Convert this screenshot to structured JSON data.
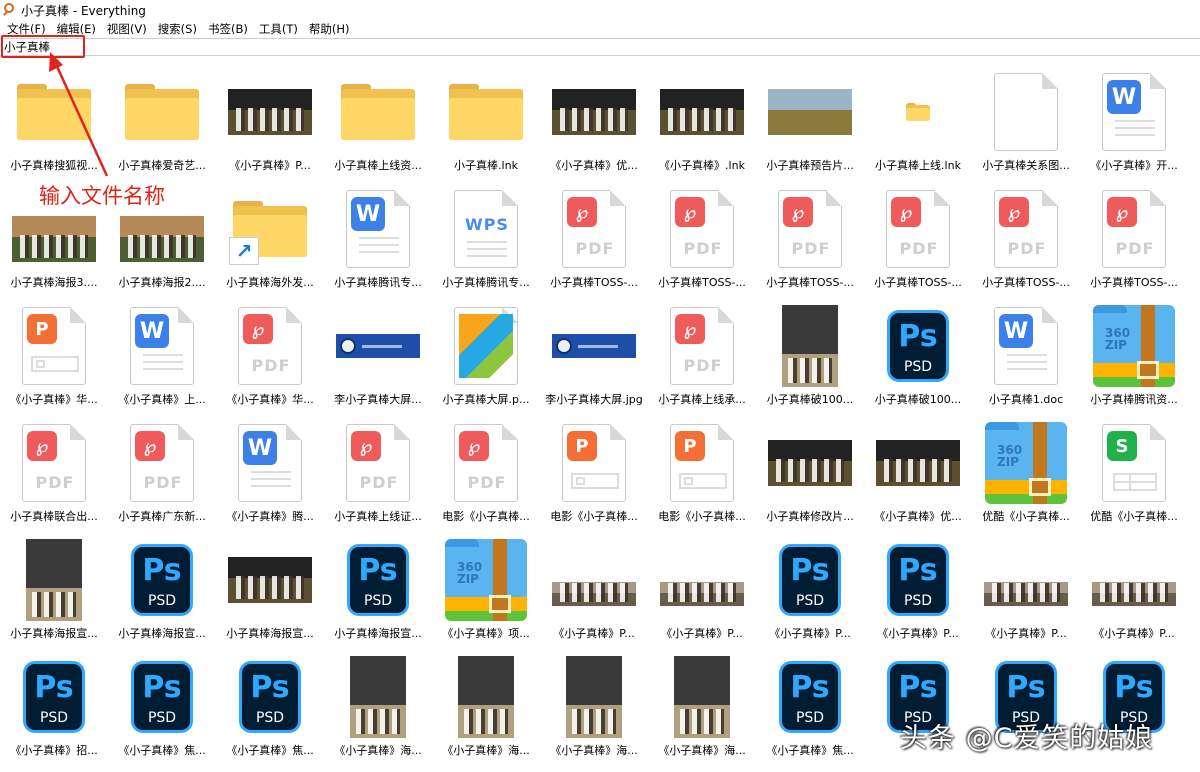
{
  "window": {
    "title": "小子真棒 - Everything"
  },
  "menu": [
    "文件(F)",
    "编辑(E)",
    "视图(V)",
    "搜索(S)",
    "书签(B)",
    "工具(T)",
    "帮助(H)"
  ],
  "search": {
    "value": "小子真棒"
  },
  "annotation": {
    "text": "输入文件名称",
    "color": "#e0231c"
  },
  "colors": {
    "ps_blue": "#31a8ff",
    "pdf_red": "#ef5a5a",
    "ppt_orange": "#f36f35",
    "word_blue": "#3d81e8",
    "xls_green": "#21b04a",
    "folder_yellow": "#ffd767"
  },
  "rows": [
    [
      {
        "icon": "folder",
        "name": "小子真棒搜狐视..."
      },
      {
        "icon": "folder",
        "name": "小子真棒爱奇艺..."
      },
      {
        "icon": "photo-dark",
        "name": "《小子真棒》P..."
      },
      {
        "icon": "folder",
        "name": "小子真棒上线资..."
      },
      {
        "icon": "folder",
        "name": "小子真棒.lnk"
      },
      {
        "icon": "photo-dark",
        "name": "《小子真棒》优..."
      },
      {
        "icon": "photo-dark",
        "name": "《小子真棒》.lnk"
      },
      {
        "icon": "photo-field",
        "name": "小子真棒预告片..."
      },
      {
        "icon": "folder-small",
        "name": "小子真棒上线.lnk"
      },
      {
        "icon": "doc-blank",
        "name": "小子真棒关系图..."
      },
      {
        "icon": "doc-word",
        "name": "《小子真棒》开..."
      }
    ],
    [
      {
        "icon": "photo-group",
        "name": "小子真棒海报3...."
      },
      {
        "icon": "photo-group",
        "name": "小子真棒海报2...."
      },
      {
        "icon": "folder-shortcut",
        "name": "小子真棒海外发..."
      },
      {
        "icon": "doc-word",
        "name": "小子真棒腾讯专..."
      },
      {
        "icon": "doc-wps",
        "name": "小子真棒腾讯专..."
      },
      {
        "icon": "doc-pdf",
        "name": "小子真棒TOSS-..."
      },
      {
        "icon": "doc-pdf",
        "name": "小子真棒TOSS-..."
      },
      {
        "icon": "doc-pdf",
        "name": "小子真棒TOSS-..."
      },
      {
        "icon": "doc-pdf",
        "name": "小子真棒TOSS-..."
      },
      {
        "icon": "doc-pdf",
        "name": "小子真棒TOSS-..."
      },
      {
        "icon": "doc-pdf",
        "name": "小子真棒TOSS-..."
      }
    ],
    [
      {
        "icon": "doc-ppt",
        "name": "《小子真棒》华..."
      },
      {
        "icon": "doc-word",
        "name": "《小子真棒》上..."
      },
      {
        "icon": "doc-pdf",
        "name": "《小子真棒》华..."
      },
      {
        "icon": "card",
        "name": "李小子真棒大屏..."
      },
      {
        "icon": "doc-image",
        "name": "小子真棒大屏.p..."
      },
      {
        "icon": "card",
        "name": "李小子真棒大屏.jpg"
      },
      {
        "icon": "doc-pdf",
        "name": "小子真棒上线承..."
      },
      {
        "icon": "photo-poster",
        "name": "小子真棒破100..."
      },
      {
        "icon": "ps",
        "name": "小子真棒破100..."
      },
      {
        "icon": "doc-word",
        "name": "小子真棒1.doc"
      },
      {
        "icon": "zip",
        "name": "小子真棒腾讯资..."
      }
    ],
    [
      {
        "icon": "doc-pdf",
        "name": "小子真棒联合出..."
      },
      {
        "icon": "doc-pdf",
        "name": "小子真棒广东新..."
      },
      {
        "icon": "doc-word",
        "name": "《小子真棒》腾..."
      },
      {
        "icon": "doc-pdf",
        "name": "小子真棒上线证..."
      },
      {
        "icon": "doc-pdf",
        "name": "电影《小子真棒..."
      },
      {
        "icon": "doc-ppt",
        "name": "电影《小子真棒..."
      },
      {
        "icon": "doc-ppt",
        "name": "电影《小子真棒..."
      },
      {
        "icon": "photo-dark",
        "name": "小子真棒修改片..."
      },
      {
        "icon": "photo-dark",
        "name": "《小子真棒》优..."
      },
      {
        "icon": "zip",
        "name": "优酷《小子真棒..."
      },
      {
        "icon": "doc-xls",
        "name": "优酷《小子真棒..."
      }
    ],
    [
      {
        "icon": "photo-poster",
        "name": "小子真棒海报宣..."
      },
      {
        "icon": "ps",
        "name": "小子真棒海报宣..."
      },
      {
        "icon": "photo-dark",
        "name": "小子真棒海报宣..."
      },
      {
        "icon": "ps",
        "name": "小子真棒海报宣..."
      },
      {
        "icon": "zip",
        "name": "《小子真棒》项..."
      },
      {
        "icon": "photo-strip",
        "name": "《小子真棒》P..."
      },
      {
        "icon": "photo-strip",
        "name": "《小子真棒》P..."
      },
      {
        "icon": "ps",
        "name": "《小子真棒》P..."
      },
      {
        "icon": "ps",
        "name": "《小子真棒》P..."
      },
      {
        "icon": "photo-strip",
        "name": "《小子真棒》P..."
      },
      {
        "icon": "photo-strip",
        "name": "《小子真棒》P..."
      }
    ],
    [
      {
        "icon": "ps",
        "name": "《小子真棒》招..."
      },
      {
        "icon": "ps",
        "name": "《小子真棒》焦..."
      },
      {
        "icon": "ps",
        "name": "《小子真棒》焦..."
      },
      {
        "icon": "photo-poster",
        "name": "《小子真棒》海..."
      },
      {
        "icon": "photo-poster",
        "name": "《小子真棒》海..."
      },
      {
        "icon": "photo-poster",
        "name": "《小子真棒》海..."
      },
      {
        "icon": "photo-poster",
        "name": "《小子真棒》海..."
      },
      {
        "icon": "ps",
        "name": "《小子真棒》焦..."
      },
      {
        "icon": "ps",
        "name": ""
      },
      {
        "icon": "ps",
        "name": ""
      },
      {
        "icon": "ps",
        "name": ""
      }
    ]
  ],
  "watermark": "头条 @C爱笑的姑娘"
}
